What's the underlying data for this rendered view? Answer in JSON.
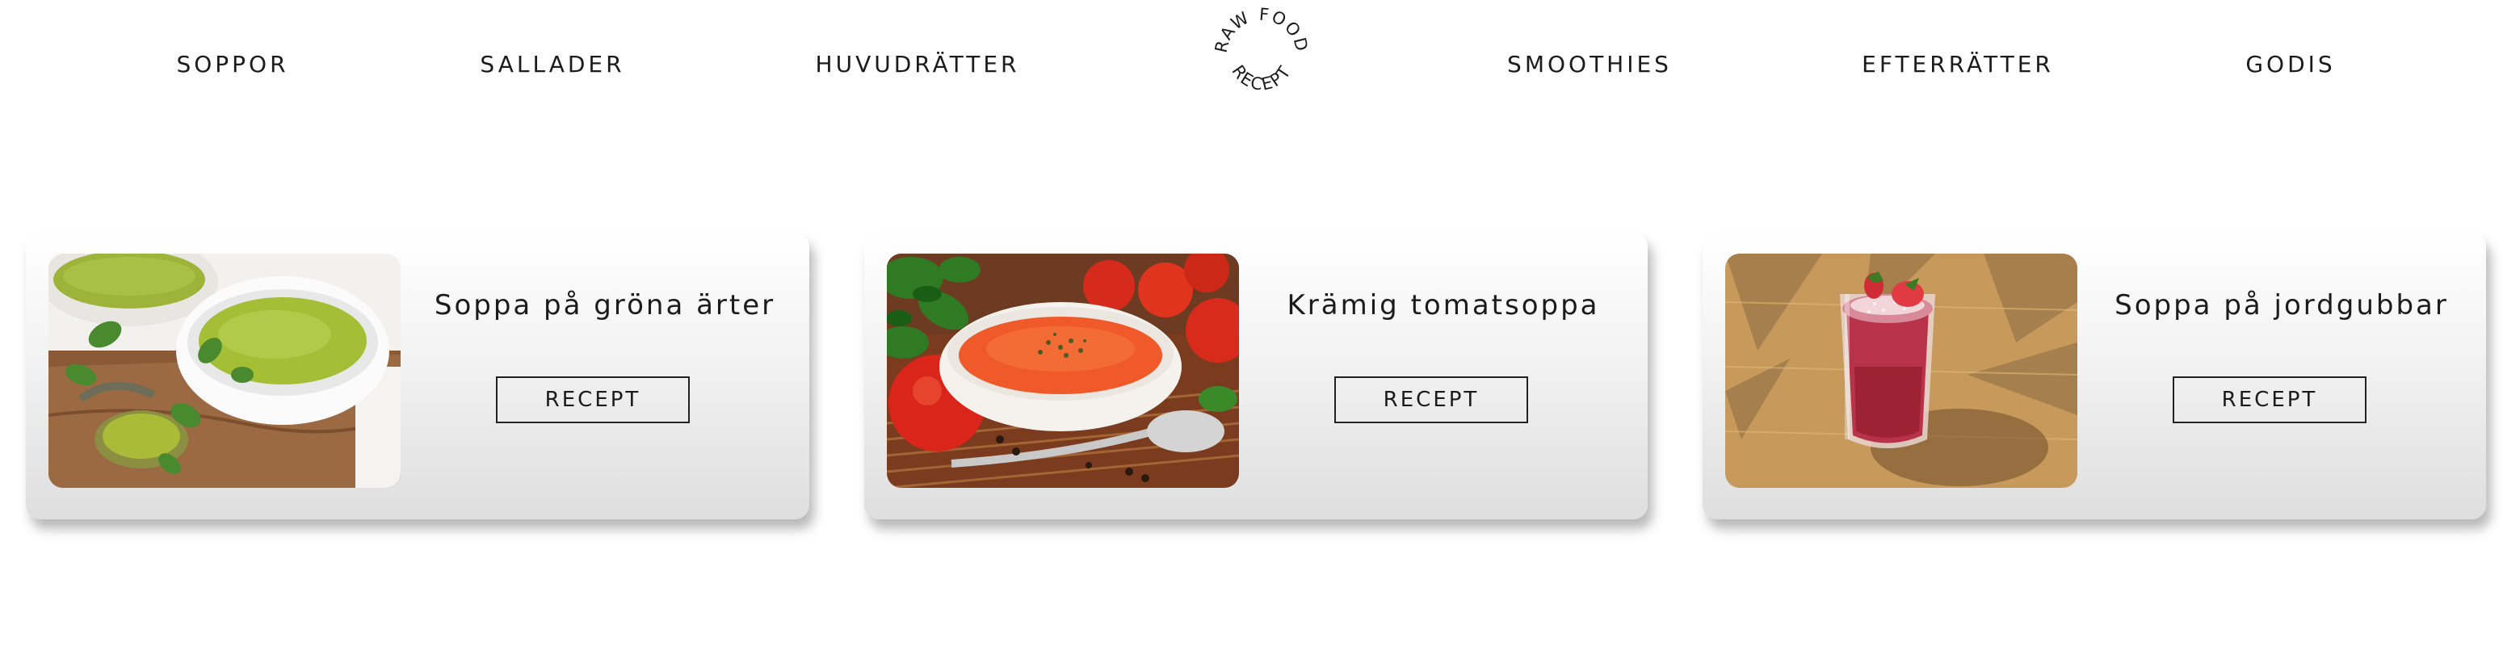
{
  "nav": {
    "items": [
      {
        "label": "SOPPOR"
      },
      {
        "label": "SALLADER"
      },
      {
        "label": "HUVUDRÄTTER"
      },
      {
        "label": "SMOOTHIES"
      },
      {
        "label": "EFTERRÄTTER"
      },
      {
        "label": "GODIS"
      }
    ],
    "logo": {
      "top_text": "RAW FOOD",
      "bottom_text": "RECEPT"
    }
  },
  "cards": [
    {
      "title": "Soppa på gröna ärter",
      "button_label": "RECEPT",
      "image": "pea-soup-photo"
    },
    {
      "title": "Krämig tomatsoppa",
      "button_label": "RECEPT",
      "image": "tomato-soup-photo"
    },
    {
      "title": "Soppa på jordgubbar",
      "button_label": "RECEPT",
      "image": "strawberry-smoothie-photo"
    }
  ],
  "colors": {
    "text": "#1b1b1b",
    "background": "#ffffff",
    "card_gradient_top": "#ffffff",
    "card_gradient_bottom": "#dedede"
  }
}
